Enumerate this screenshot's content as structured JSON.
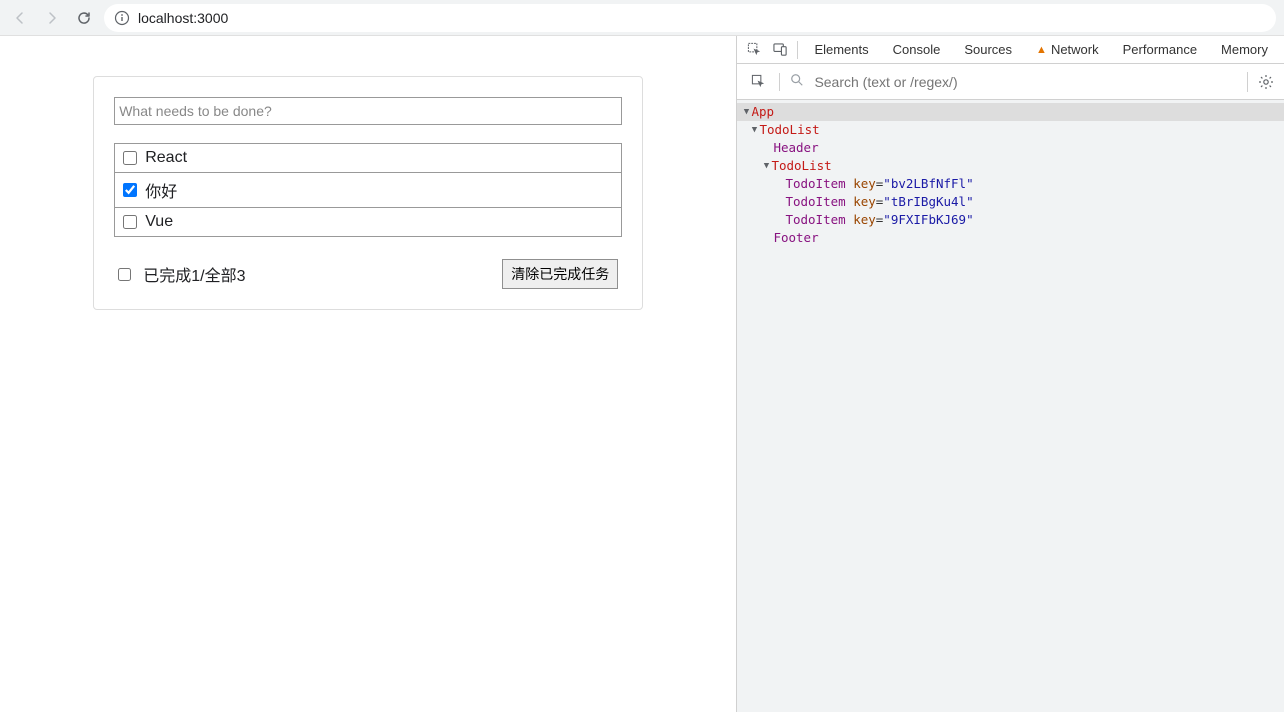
{
  "browser": {
    "url": "localhost:3000"
  },
  "todo": {
    "input_placeholder": "What needs to be done?",
    "items": [
      {
        "label": "React",
        "checked": false
      },
      {
        "label": "你好",
        "checked": true
      },
      {
        "label": "Vue",
        "checked": false
      }
    ],
    "footer_status": "已完成1/全部3",
    "clear_btn": "清除已完成任务"
  },
  "devtools": {
    "tabs": {
      "elements": "Elements",
      "console": "Console",
      "sources": "Sources",
      "network": "Network",
      "performance": "Performance",
      "memory": "Memory"
    },
    "search_placeholder": "Search (text or /regex/)",
    "tree": {
      "app": "App",
      "todolist1": "TodoList",
      "header": "Header",
      "todolist2": "TodoList",
      "items": [
        {
          "comp": "TodoItem",
          "key_label": "key",
          "key_val": "\"bv2LBfNfFl\""
        },
        {
          "comp": "TodoItem",
          "key_label": "key",
          "key_val": "\"tBrIBgKu4l\""
        },
        {
          "comp": "TodoItem",
          "key_label": "key",
          "key_val": "\"9FXIFbKJ69\""
        }
      ],
      "footer": "Footer"
    }
  }
}
